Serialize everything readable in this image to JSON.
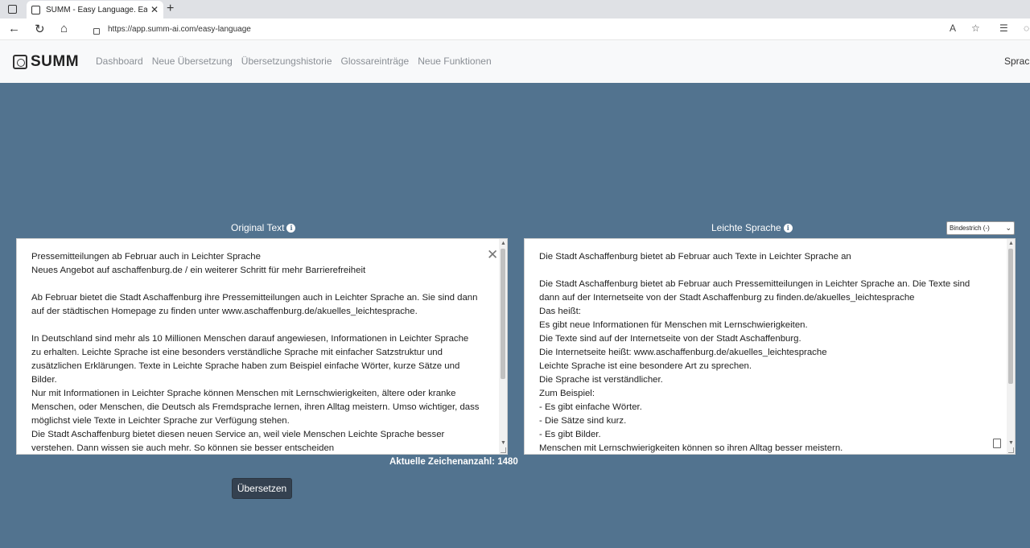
{
  "browser": {
    "tab_title": "SUMM - Easy Language. Easily M",
    "url": "https://app.summ-ai.com/easy-language"
  },
  "header": {
    "logo_text": "SUMM",
    "nav": [
      "Dashboard",
      "Neue Übersetzung",
      "Übersetzungshistorie",
      "Glossareinträge",
      "Neue Funktionen"
    ],
    "right_link": "Sprach"
  },
  "original": {
    "title": "Original Text",
    "text": "Pressemitteilungen ab Februar auch in Leichter Sprache\nNeues Angebot auf aschaffenburg.de / ein weiterer Schritt für mehr Barrierefreiheit\n\nAb Februar bietet die Stadt Aschaffenburg ihre Pressemitteilungen auch in Leichter Sprache an. Sie sind dann\nauf der städtischen Homepage zu finden unter www.aschaffenburg.de/akuelles_leichtesprache.\n\nIn Deutschland sind mehr als 10 Millionen Menschen darauf angewiesen, Informationen in Leichter Sprache\nzu erhalten. Leichte Sprache ist eine besonders verständliche Sprache mit einfacher Satzstruktur und\nzusätzlichen Erklärungen. Texte in Leichte Sprache haben zum Beispiel einfache Wörter, kurze Sätze und\nBilder.\nNur mit Informationen in Leichter Sprache können Menschen mit Lernschwierigkeiten, ältere oder kranke\nMenschen, oder Menschen, die Deutsch als Fremdsprache lernen, ihren Alltag meistern. Umso wichtiger, dass\nmöglichst viele Texte in Leichter Sprache zur Verfügung stehen.\nDie Stadt Aschaffenburg bietet diesen neuen Service an, weil viele Menschen Leichte Sprache besser\nverstehen. Dann wissen sie auch mehr. So können sie besser entscheiden",
    "char_count": "Aktuelle Zeichenanzahl: 1480"
  },
  "easy": {
    "title": "Leichte Sprache",
    "hyphen_option": "Bindestrich (-)",
    "text": "Die Stadt Aschaffenburg bietet ab Februar auch Texte in Leichter Sprache an\n\nDie Stadt Aschaffenburg bietet ab Februar auch Pressemitteilungen in Leichter Sprache an. Die Texte sind\ndann auf der Internetseite von der Stadt Aschaffenburg zu finden.de/akuelles_leichtesprache\nDas heißt:\nEs gibt neue Informationen für Menschen mit Lernschwierigkeiten.\nDie Texte sind auf der Internetseite von der Stadt Aschaffenburg.\nDie Internetseite heißt: www.aschaffenburg.de/akuelles_leichtesprache\nLeichte Sprache ist eine besondere Art zu sprechen.\nDie Sprache ist verständlicher.\nZum Beispiel:\n- Es gibt einfache Wörter.\n- Die Sätze sind kurz.\n- Es gibt Bilder.\nMenschen mit Lernschwierigkeiten können so ihren Alltag besser meistern."
  },
  "actions": {
    "translate": "Übersetzen"
  },
  "colors": {
    "background": "#52738f",
    "button": "#344150"
  }
}
